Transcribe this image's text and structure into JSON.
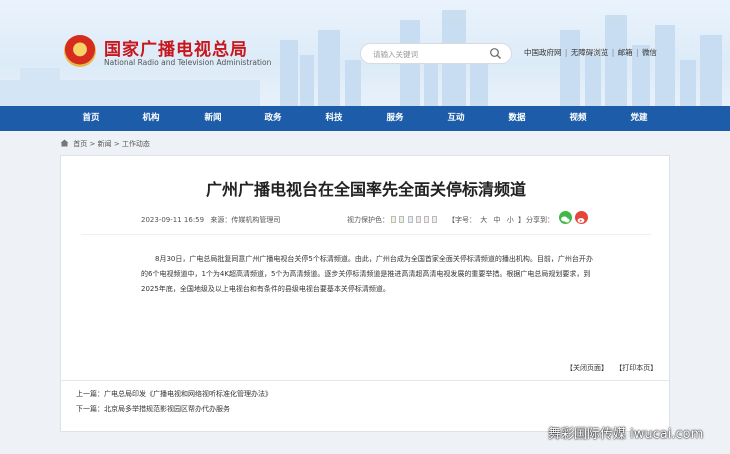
{
  "header": {
    "site_name_cn": "国家广播电视总局",
    "site_name_en": "National Radio and Television Administration",
    "search_placeholder": "请输入关键词",
    "top_links": [
      "中国政府网",
      "无障碍浏览",
      "邮箱",
      "微信"
    ],
    "top_link_sep": "|"
  },
  "nav": {
    "items": [
      "首页",
      "机构",
      "新闻",
      "政务",
      "科技",
      "服务",
      "互动",
      "数据",
      "视频",
      "党建"
    ]
  },
  "breadcrumb": [
    "首页",
    "新闻",
    "工作动态"
  ],
  "breadcrumb_sep": ">",
  "article": {
    "title": "广州广播电视台在全国率先全面关停标清频道",
    "date": "2023-09-11 16:59",
    "source": "来源：传媒机构管理司",
    "vision_label": "视力保护色：",
    "vision_colors": [
      "#f4f4d8",
      "#e6f2dc",
      "#e0ecf6",
      "#f2e6f2",
      "#f6eaea",
      "#eeeeee"
    ],
    "font_label": "【字号：",
    "font_sizes": [
      "大",
      "中",
      "小"
    ],
    "font_end": "】",
    "share_label": "分享到：",
    "body": "8月30日，广电总局批复同意广州广播电视台关停5个标清频道。由此，广州台成为全国首家全面关停标清频道的播出机构。目前，广州台开办的6个电视频道中，1个为4K超高清频道，5个为高清频道。逐步关停标清频道是推进高清超高清电视发展的重要举措。根据广电总局规划要求，到2025年底，全国地级及以上电视台和有条件的县级电视台要基本关停标清频道。",
    "close_label": "【关闭页面】",
    "print_label": "【打印本页】",
    "prev_label": "上一篇：",
    "prev_title": "广电总局印发《广播电视和网络视听标准化管理办法》",
    "next_label": "下一篇：",
    "next_title": "北京局多举措规范影视园区帮办代办服务"
  },
  "watermark": "舞彩国际传媒 iwucai.com"
}
